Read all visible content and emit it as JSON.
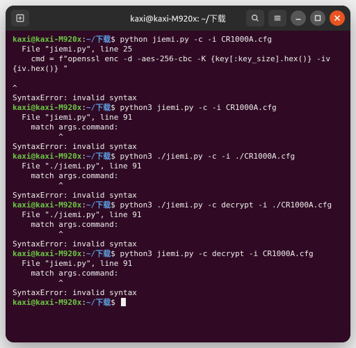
{
  "window": {
    "title": "kaxi@kaxi-M920x: ~/下载"
  },
  "prompt": {
    "user_host": "kaxi@kaxi-M920x",
    "path_sep": ":",
    "path": "~/下载",
    "marker": "$ "
  },
  "blocks": [
    {
      "command": "python jiemi.py -c -i CR1000A.cfg",
      "output": [
        "  File \"jiemi.py\", line 25",
        "    cmd = f\"openssl enc -d -aes-256-cbc -K {key[:key_size].hex()} -iv {iv.hex()} \"",
        "                                                                                 ^",
        "SyntaxError: invalid syntax"
      ]
    },
    {
      "command": "python3 jiemi.py -c -i CR1000A.cfg",
      "output": [
        "  File \"jiemi.py\", line 91",
        "    match args.command:",
        "          ^",
        "SyntaxError: invalid syntax"
      ]
    },
    {
      "command": "python3 ./jiemi.py -c -i ./CR1000A.cfg",
      "output": [
        "  File \"./jiemi.py\", line 91",
        "    match args.command:",
        "          ^",
        "SyntaxError: invalid syntax"
      ]
    },
    {
      "command": "python3 ./jiemi.py -c decrypt -i ./CR1000A.cfg",
      "output": [
        "  File \"./jiemi.py\", line 91",
        "    match args.command:",
        "          ^",
        "SyntaxError: invalid syntax"
      ]
    },
    {
      "command": "python3 jiemi.py -c decrypt -i CR1000A.cfg",
      "output": [
        "  File \"jiemi.py\", line 91",
        "    match args.command:",
        "          ^",
        "SyntaxError: invalid syntax"
      ]
    }
  ],
  "final_prompt_empty": true
}
